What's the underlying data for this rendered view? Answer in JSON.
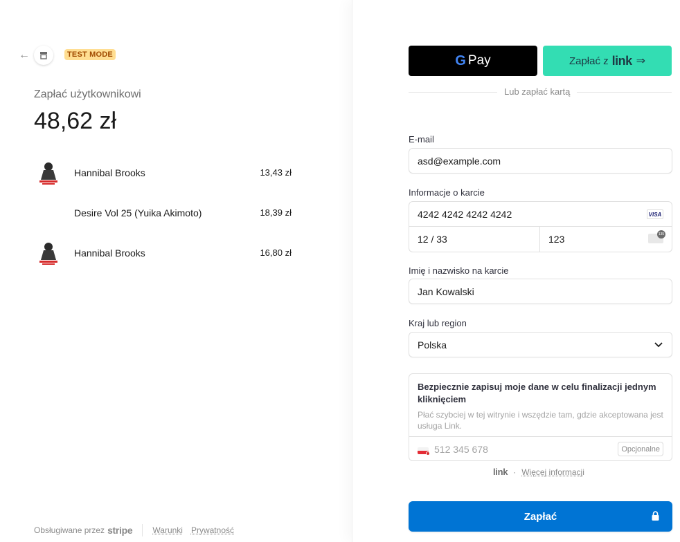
{
  "merchant": {
    "test_badge": "TEST MODE",
    "pay_label": "Zapłać użytkownikowi",
    "amount": "48,62 zł"
  },
  "line_items": [
    {
      "name": "Hannibal Brooks",
      "price": "13,43 zł",
      "has_thumb": true
    },
    {
      "name": "Desire Vol 25 (Yuika Akimoto)",
      "price": "18,39 zł",
      "has_thumb": false
    },
    {
      "name": "Hannibal Brooks",
      "price": "16,80 zł",
      "has_thumb": true
    }
  ],
  "footer": {
    "powered_by": "Obsługiwane przez",
    "stripe": "stripe",
    "terms": "Warunki",
    "privacy": "Prywatność"
  },
  "wallets": {
    "gpay_g": "G",
    "gpay_label": "Pay",
    "link_label": "Zapłać z",
    "link_brand": "link",
    "divider": "Lub zapłać kartą"
  },
  "form": {
    "email_label": "E-mail",
    "email_value": "asd@example.com",
    "card_label": "Informacje o karcie",
    "card_number": "4242 4242 4242 4242",
    "card_brand": "VISA",
    "card_expiry": "12 / 33",
    "card_cvc": "123",
    "name_label": "Imię i nazwisko na karcie",
    "name_value": "Jan Kowalski",
    "country_label": "Kraj lub region",
    "country_value": "Polska"
  },
  "save": {
    "title": "Bezpiecznie zapisuj moje dane w celu finalizacji jednym kliknięciem",
    "description": "Płać szybciej w tej witrynie i wszędzie tam, gdzie akceptowana jest usługa Link.",
    "phone_placeholder": "512 345 678",
    "optional": "Opcjonalne"
  },
  "link_info": {
    "brand": "link",
    "more": "Więcej informacji"
  },
  "pay_button": "Zapłać",
  "colors": {
    "pay_button": "#0074d4",
    "link_button": "#33ddb3",
    "gpay_button": "#000000",
    "test_badge_bg": "#ffde92",
    "test_badge_text": "#a04a00"
  }
}
